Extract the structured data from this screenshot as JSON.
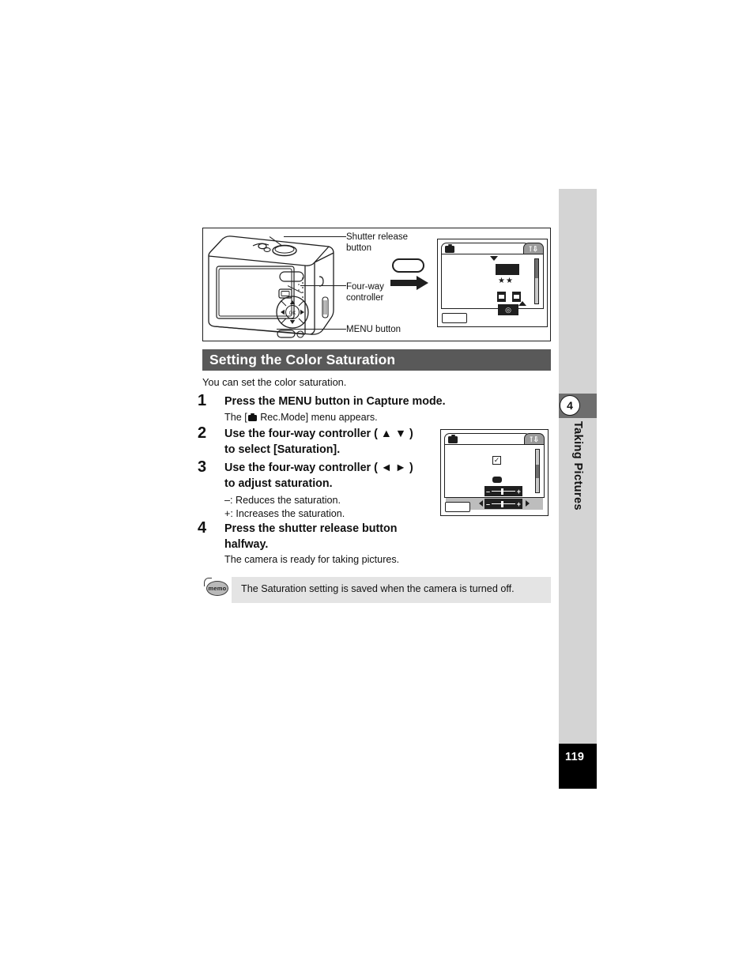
{
  "figure": {
    "callouts": [
      {
        "id": "shutter",
        "line1": "Shutter release",
        "line2": "button"
      },
      {
        "id": "fourway",
        "line1": "Four-way",
        "line2": "controller"
      },
      {
        "id": "menu",
        "line1": "MENU button",
        "line2": ""
      }
    ],
    "lcd_capture": {
      "quality_stars": "★★",
      "tab_left_icon": "rec-mode-camera-icon",
      "tab_right_icon": "setup-wrench-icon"
    },
    "lcd_menu": {
      "tab_left_icon": "rec-mode-camera-icon",
      "tab_right_icon": "setup-wrench-icon",
      "slider_minus": "–",
      "slider_plus": "+"
    }
  },
  "section": {
    "heading": "Setting the Color Saturation",
    "intro": "You can set the color saturation."
  },
  "steps": [
    {
      "number": "1",
      "title": "Press the MENU button in Capture mode.",
      "body_prefix": "The [",
      "body_icon": "rec-mode-camera-icon",
      "body_suffix": " Rec.Mode] menu appears."
    },
    {
      "number": "2",
      "title_line1": "Use the four-way controller ( ▲ ▼ )",
      "title_line2": "to select [Saturation]."
    },
    {
      "number": "3",
      "title_line1": "Use the four-way controller ( ◄ ► )",
      "title_line2": "to adjust saturation.",
      "body_line1": "–: Reduces the saturation.",
      "body_line2": "+: Increases the saturation."
    },
    {
      "number": "4",
      "title_line1": "Press the shutter release button",
      "title_line2": "halfway.",
      "body_line1": "The camera is ready for taking pictures."
    }
  ],
  "memo": {
    "badge_label": "memo",
    "text": "The Saturation setting is saved when the camera is turned off."
  },
  "sidebar": {
    "chapter_number": "4",
    "chapter_title": "Taking Pictures",
    "page_number": "119"
  },
  "colors": {
    "heading_bar": "#595959",
    "sidebar_rail": "#d4d4d4",
    "sidebar_tab": "#6e6e6e",
    "page_tab": "#000000",
    "memo_bg": "#e4e4e4"
  }
}
